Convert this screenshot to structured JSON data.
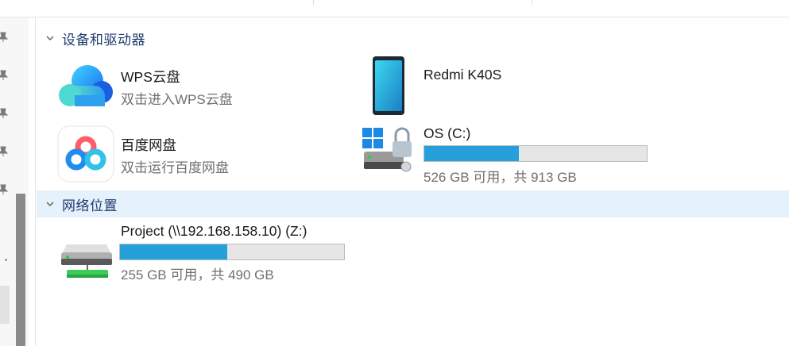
{
  "sections": {
    "devices": {
      "title": "设备和驱动器",
      "items": [
        {
          "name": "WPS云盘",
          "subtitle": "双击进入WPS云盘",
          "icon": "wps-cloud-icon"
        },
        {
          "name": "Redmi K40S",
          "icon": "phone-icon"
        },
        {
          "name": "百度网盘",
          "subtitle": "双击运行百度网盘",
          "icon": "baidu-netdisk-icon"
        },
        {
          "name": "OS (C:)",
          "capacity": "526 GB 可用，共 913 GB",
          "used_fraction": 0.424,
          "icon": "windows-drive-lock-icon"
        }
      ]
    },
    "network": {
      "title": "网络位置",
      "items": [
        {
          "name": "Project (\\\\192.168.158.10) (Z:)",
          "capacity": "255 GB 可用，共 490 GB",
          "used_fraction": 0.48,
          "icon": "network-drive-icon"
        }
      ]
    }
  },
  "colors": {
    "accent": "#26a0da",
    "selection": "#e5f1fb",
    "header_text": "#1e3a6e"
  }
}
